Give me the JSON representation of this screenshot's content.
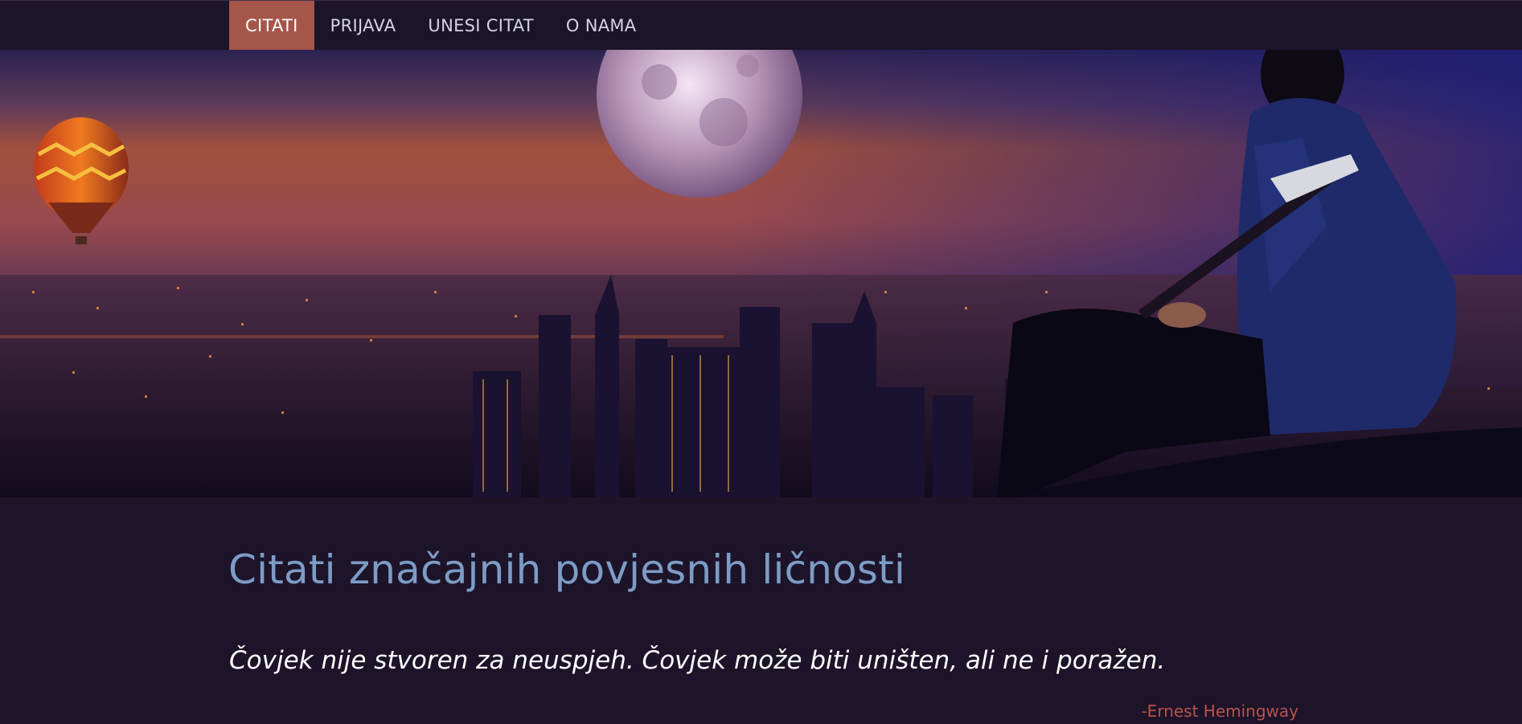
{
  "nav": {
    "items": [
      {
        "label": "CITATI",
        "active": true
      },
      {
        "label": "PRIJAVA",
        "active": false
      },
      {
        "label": "UNESI CITAT",
        "active": false
      },
      {
        "label": "O NAMA",
        "active": false
      }
    ]
  },
  "main": {
    "title": "Citati značajnih povjesnih ličnosti",
    "quote": {
      "text": "Čovjek nije stvoren za neuspjeh. Čovjek može biti uništen, ali ne i poražen.",
      "author": "-Ernest Hemingway"
    }
  },
  "colors": {
    "background": "#1d1429",
    "nav_active": "#a5564a",
    "title": "#7d9cc6",
    "author": "#b8524c"
  }
}
